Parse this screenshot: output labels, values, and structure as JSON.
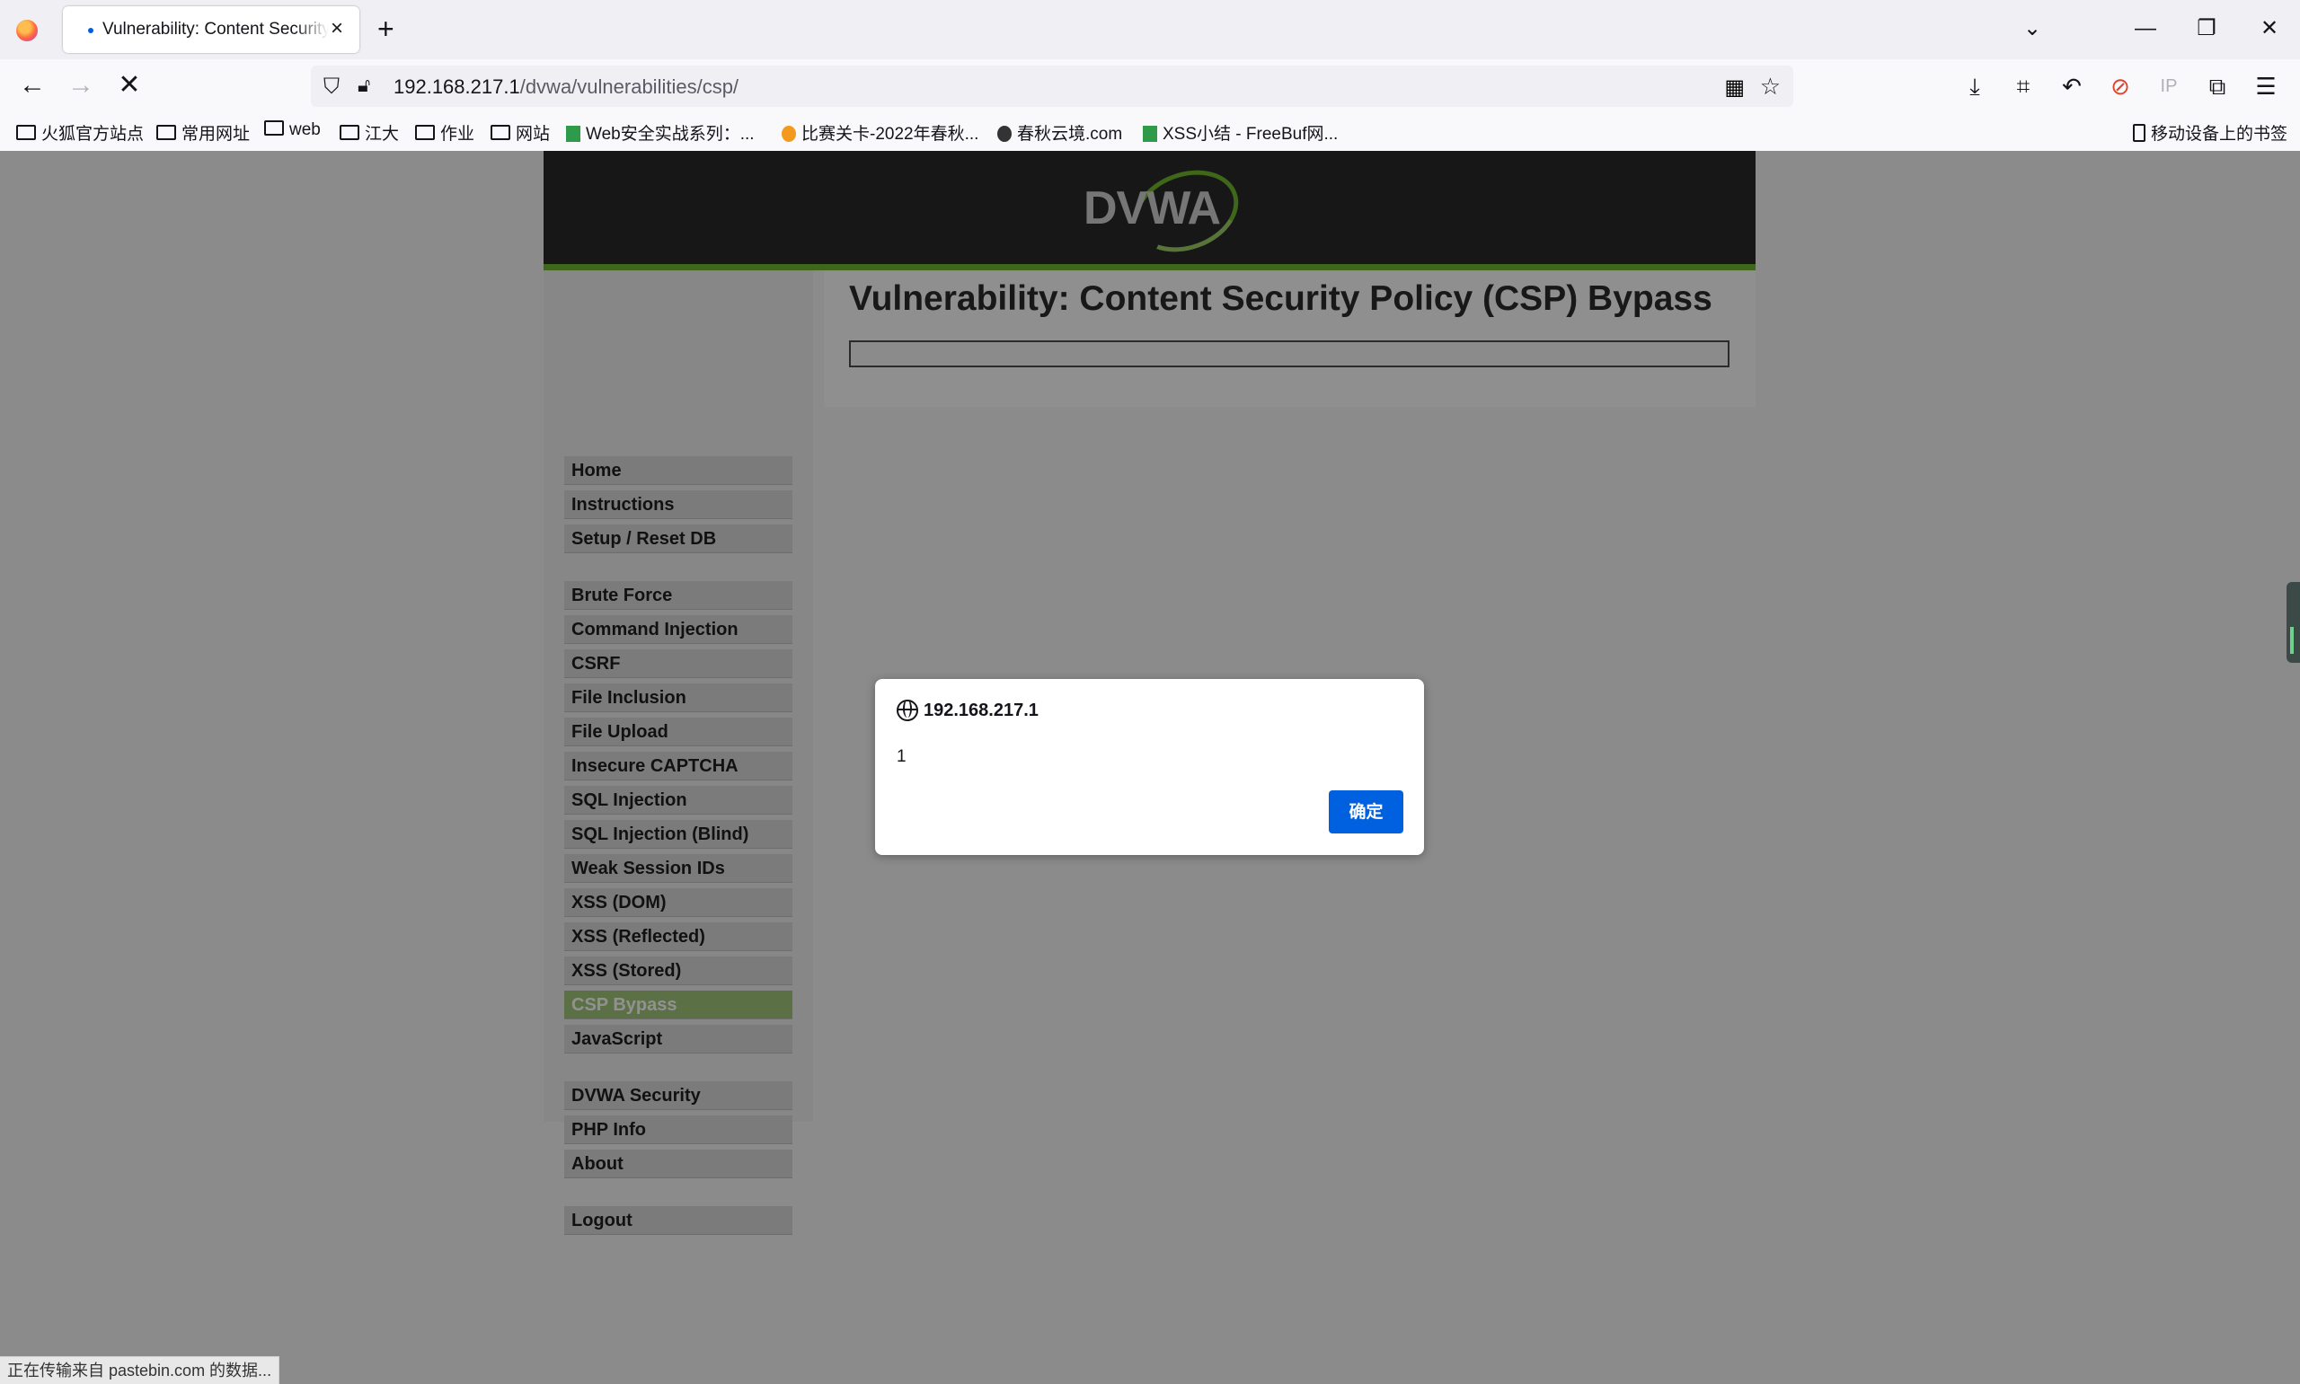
{
  "browser": {
    "tab": {
      "title": "Vulnerability: Content Security Policy (CSP) Bypass",
      "close": "×"
    },
    "new_tab": "+",
    "window_controls": {
      "list": "⌄",
      "minimize": "—",
      "restore": "❐",
      "close": "✕"
    },
    "nav": {
      "back": "←",
      "forward": "→",
      "stop": "✕"
    },
    "url": {
      "host": "192.168.217.1",
      "path": "/dvwa/vulnerabilities/csp/"
    },
    "bookmarks": [
      "火狐官方站点",
      "常用网址",
      "web",
      "江大",
      "作业",
      "网站",
      "Web安全实战系列：...",
      "比赛关卡-2022年春秋...",
      "春秋云境.com",
      "XSS小结 - FreeBuf网..."
    ],
    "mobile_bookmarks": "移动设备上的书签",
    "ip_label": "IP",
    "status": "正在传输来自 pastebin.com 的数据..."
  },
  "dvwa": {
    "logo": "DVWA",
    "menu": {
      "group1": [
        "Home",
        "Instructions",
        "Setup / Reset DB"
      ],
      "group2": [
        "Brute Force",
        "Command Injection",
        "CSRF",
        "File Inclusion",
        "File Upload",
        "Insecure CAPTCHA",
        "SQL Injection",
        "SQL Injection (Blind)",
        "Weak Session IDs",
        "XSS (DOM)",
        "XSS (Reflected)",
        "XSS (Stored)",
        "CSP Bypass",
        "JavaScript"
      ],
      "group3": [
        "DVWA Security",
        "PHP Info",
        "About"
      ],
      "group4": [
        "Logout"
      ],
      "active": "CSP Bypass"
    },
    "page_title": "Vulnerability: Content Security Policy (CSP) Bypass"
  },
  "dialog": {
    "origin": "192.168.217.1",
    "message": "1",
    "ok_label": "确定"
  },
  "colors": {
    "accent_green": "#6fb52c",
    "active_menu": "#a3c67a",
    "ok_button": "#0061e0"
  }
}
